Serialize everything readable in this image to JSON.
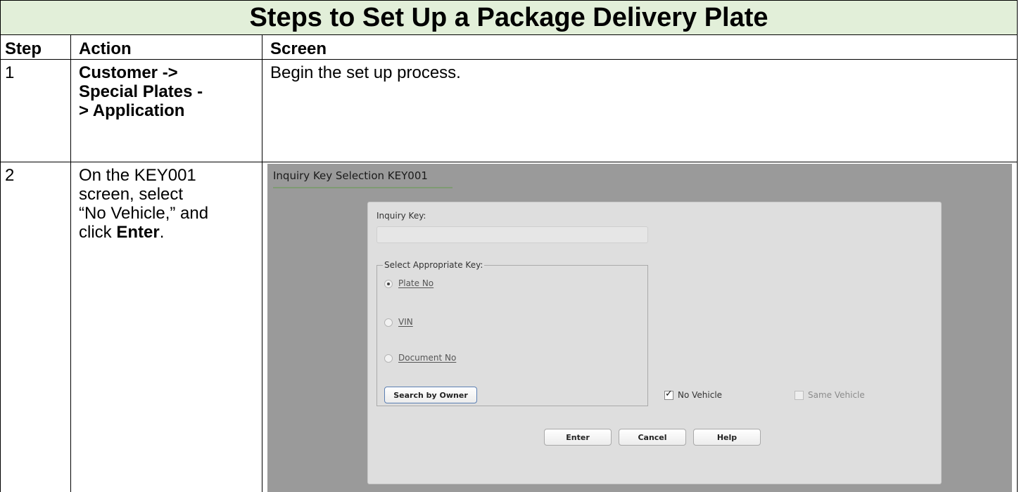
{
  "title": "Steps to Set Up a Package Delivery Plate",
  "headers": {
    "step": "Step",
    "action": "Action",
    "screen": "Screen"
  },
  "rows": [
    {
      "step": "1",
      "action_lines": [
        "Customer ->",
        "Special Plates -",
        "> Application"
      ],
      "screen_text": "Begin the set up process."
    },
    {
      "step": "2",
      "action_lines": [
        "On the KEY001",
        "screen, select",
        "“No Vehicle,” and"
      ],
      "action_last_prefix": "click ",
      "action_last_bold": "Enter",
      "action_last_suffix": "."
    }
  ],
  "screenshot": {
    "title": "Inquiry Key Selection KEY001",
    "inquiry_key_label": "Inquiry Key:",
    "inquiry_key_value": "",
    "group_label": "Select Appropriate Key:",
    "radios": [
      {
        "label": "Plate No",
        "selected": true
      },
      {
        "label": "VIN",
        "selected": false
      },
      {
        "label": "Document No",
        "selected": false
      }
    ],
    "search_by_owner": "Search by Owner",
    "no_vehicle": {
      "label": "No Vehicle",
      "checked": true
    },
    "same_vehicle": {
      "label": "Same Vehicle",
      "checked": false
    },
    "buttons": {
      "enter": "Enter",
      "cancel": "Cancel",
      "help": "Help"
    },
    "colors": {
      "background": "#9a9a9a",
      "panel": "#dedede",
      "title_underline": "#7f9b73"
    }
  },
  "colors": {
    "title_band": "#e2efd9",
    "grid": "#000000"
  }
}
